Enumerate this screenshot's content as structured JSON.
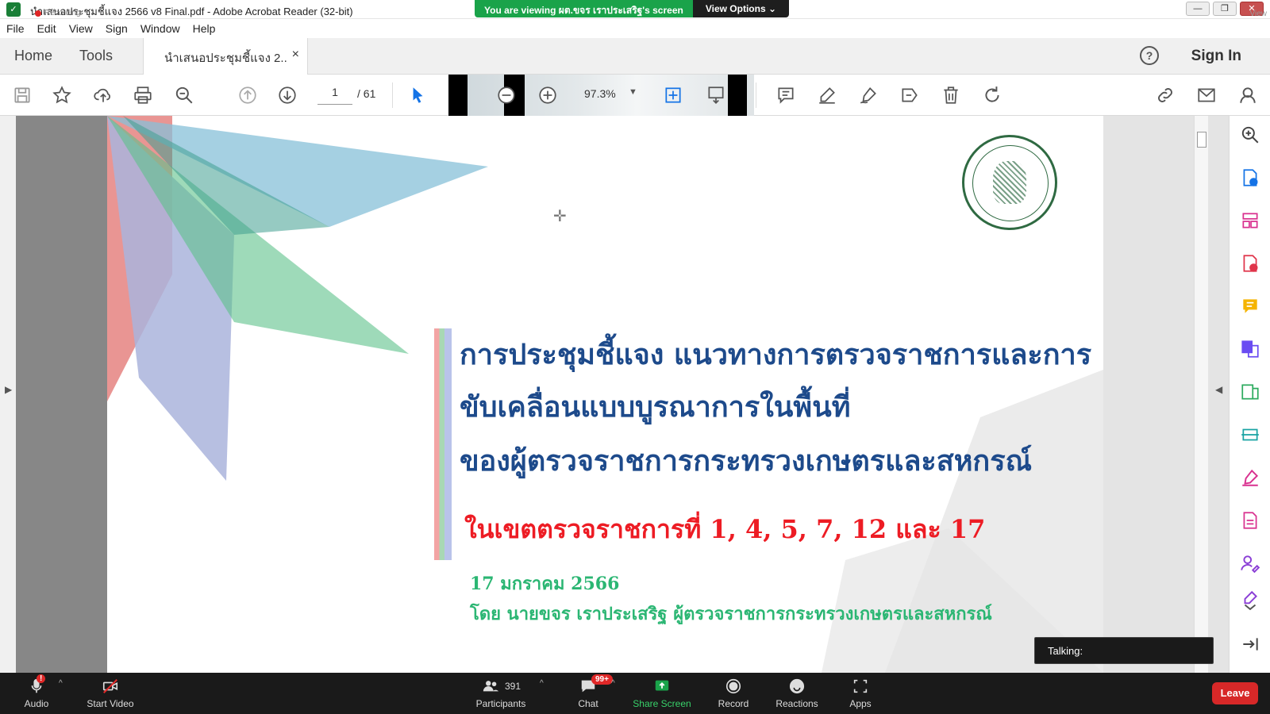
{
  "window": {
    "title": "นำเสนอประชุมชี้แจง 2566 v8 Final.pdf - Adobe Acrobat Reader (32-bit)",
    "recording_label": "Recording",
    "share_banner": "You are viewing ผต.ขจร เราประเสริฐ's screen",
    "view_options": "View Options ⌄",
    "view_tag": "View"
  },
  "menu": [
    "File",
    "Edit",
    "View",
    "Sign",
    "Window",
    "Help"
  ],
  "tabs": {
    "home": "Home",
    "tools": "Tools",
    "document": "นำเสนอประชุมชี้แจง 2...",
    "close": "×",
    "sign_in": "Sign In",
    "help": "?"
  },
  "toolbar": {
    "current_page": "1",
    "total_pages": "/ 61",
    "zoom": "97.3%"
  },
  "document": {
    "title_line1": "การประชุมชี้แจง แนวทางการตรวจราชการและการ",
    "title_line2": "ขับเคลื่อนแบบบูรณาการในพื้นที่",
    "title_line3": "ของผู้ตรวจราชการกระทรวงเกษตรและสหกรณ์",
    "region": "ในเขตตรวจราชการที่ 1, 4, 5, 7, 12 และ 17",
    "date": "17 มกราคม 2566",
    "presenter": "โดย นายขจร เราประเสริฐ ผู้ตรวจราชการกระทรวงเกษตรและสหกรณ์"
  },
  "toast": {
    "talking": "Talking:"
  },
  "meeting": {
    "audio": "Audio",
    "start_video": "Start Video",
    "participants": "Participants",
    "participants_count": "391",
    "chat": "Chat",
    "chat_badge": "99+",
    "share_screen": "Share Screen",
    "record": "Record",
    "reactions": "Reactions",
    "apps": "Apps",
    "leave": "Leave"
  },
  "colors": {
    "title_blue": "#1d4a8b",
    "region_red": "#ed1c24",
    "date_green": "#2bb673",
    "share_green": "#1aa34a",
    "leave_red": "#d72828"
  }
}
